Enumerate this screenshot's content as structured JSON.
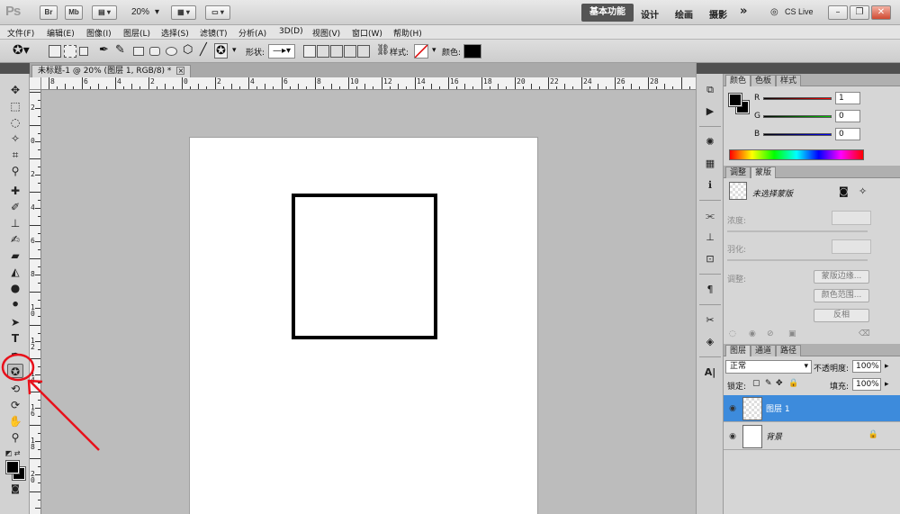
{
  "app": {
    "logo": "Ps",
    "title_buttons": [
      "Br",
      "Mb"
    ],
    "zoom": "20%",
    "workspaces": {
      "active": "基本功能",
      "items": [
        "设计",
        "绘画",
        "摄影"
      ],
      "more": "»"
    },
    "cs_live": "CS Live"
  },
  "menu": [
    "文件(F)",
    "编辑(E)",
    "图像(I)",
    "图层(L)",
    "选择(S)",
    "滤镜(T)",
    "分析(A)",
    "3D(D)",
    "视图(V)",
    "窗口(W)",
    "帮助(H)"
  ],
  "options": {
    "shape_label": "形状:",
    "style_label": "样式:",
    "color_label": "颜色:",
    "color_value": "#000000"
  },
  "document": {
    "tab_title": "未标题-1 @ 20% (图层 1, RGB/8) *",
    "close": "×"
  },
  "rulers": {
    "h_labels": [
      "8",
      "6",
      "4",
      "2",
      "0",
      "2",
      "4",
      "6",
      "8",
      "10",
      "12",
      "14",
      "16",
      "18",
      "20",
      "22",
      "24",
      "26",
      "28"
    ],
    "v_labels": [
      "2",
      "0",
      "2",
      "4",
      "6",
      "8",
      "1 0",
      "1 2",
      "1 4",
      "1 6",
      "1 8",
      "2 0"
    ]
  },
  "color_panel": {
    "tabs": [
      "颜色",
      "色板",
      "样式"
    ],
    "channels": [
      {
        "label": "R",
        "value": "1"
      },
      {
        "label": "G",
        "value": "0"
      },
      {
        "label": "B",
        "value": "0"
      }
    ]
  },
  "masks_panel": {
    "tabs": [
      "调整",
      "蒙版"
    ],
    "status": "未选择蒙版",
    "density_label": "浓度:",
    "feather_label": "羽化:",
    "refine_label": "调整:",
    "buttons": [
      "蒙版边缘...",
      "颜色范围...",
      "反相"
    ]
  },
  "layers_panel": {
    "tabs": [
      "图层",
      "通道",
      "路径"
    ],
    "blend_mode": "正常",
    "opacity_label": "不透明度:",
    "opacity_value": "100%",
    "lock_label": "锁定:",
    "fill_label": "填充:",
    "fill_value": "100%",
    "layers": [
      {
        "name": "图层 1",
        "selected": true
      },
      {
        "name": "背景",
        "selected": false
      }
    ]
  }
}
